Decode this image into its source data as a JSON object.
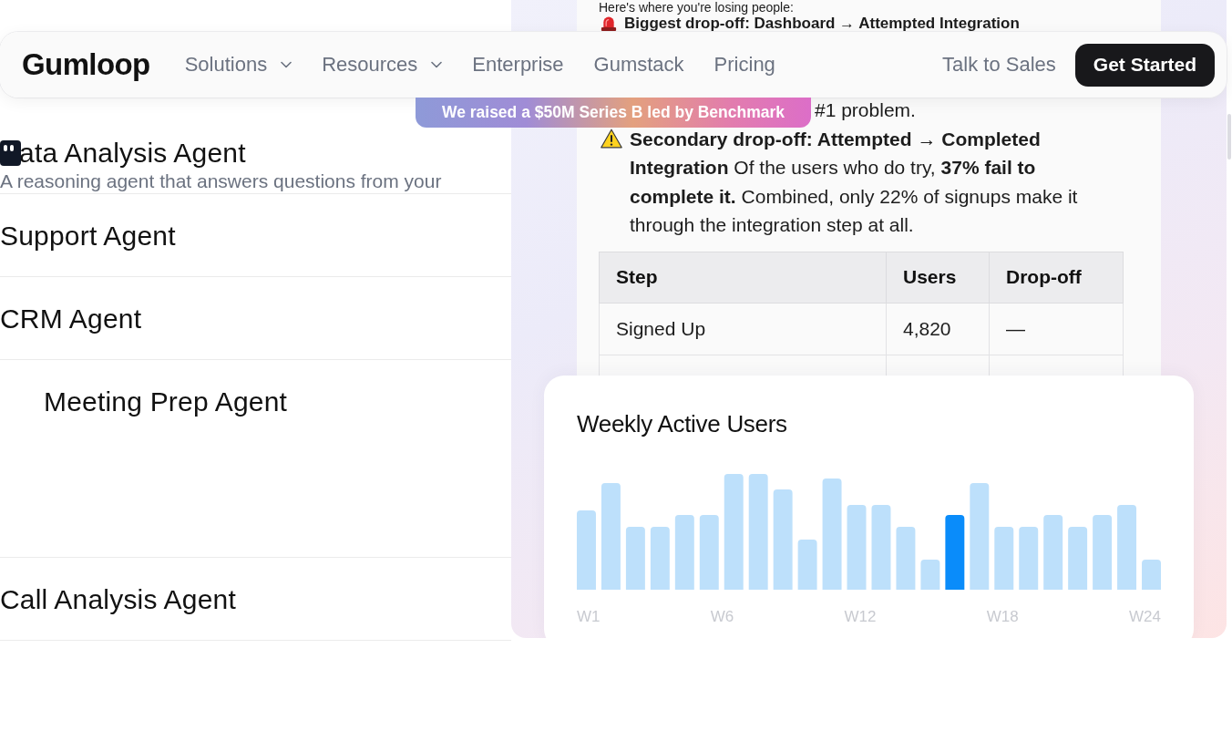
{
  "navbar": {
    "logo": "Gumloop",
    "links": [
      {
        "label": "Solutions",
        "kind": "dropdown"
      },
      {
        "label": "Resources",
        "kind": "dropdown"
      },
      {
        "label": "Enterprise",
        "kind": "link"
      },
      {
        "label": "Gumstack",
        "kind": "link"
      },
      {
        "label": "Pricing",
        "kind": "link"
      }
    ],
    "secondary_action": "Talk to Sales",
    "primary_action": "Get Started"
  },
  "announcement": "We raised a $50M Series B led by Benchmark",
  "agents": [
    {
      "kind": "featured",
      "title": "ata Analysis Agent",
      "description": "A reasoning agent that answers questions from your"
    },
    {
      "kind": "plain",
      "title": "Support Agent"
    },
    {
      "kind": "plain",
      "title": "CRM Agent"
    },
    {
      "kind": "expanded",
      "title": "Meeting Prep Agent"
    },
    {
      "kind": "plain",
      "title": "Call Analysis Agent"
    }
  ],
  "report": {
    "intro": "Here's where you're losing people:",
    "blocks": [
      {
        "kind": "alert",
        "text": "Biggest drop-off: Dashboard → Attempted Integration"
      },
      {
        "kind": "fragment",
        "text": "#1 problem."
      },
      {
        "kind": "warning",
        "text": "**Secondary drop-off: Attempted → Completed Integration** Of the users who do try, **37% fail to complete it.** Combined, only 22% of signups make it through the integration step at all."
      }
    ],
    "table": {
      "columns": [
        "Step",
        "Users",
        "Drop-off"
      ],
      "rows": [
        [
          "Signed Up",
          "4,820",
          "—"
        ]
      ]
    }
  },
  "chart": {
    "title": "Weekly Active Users",
    "x_labels": [
      "W1",
      "W6",
      "W12",
      "W18",
      "W24"
    ],
    "bars": [
      {
        "selected": false
      },
      {
        "selected": false
      },
      {
        "selected": false
      },
      {
        "selected": false
      },
      {
        "selected": false
      },
      {
        "selected": false
      },
      {
        "selected": false
      },
      {
        "selected": false
      },
      {
        "selected": false
      },
      {
        "selected": false
      },
      {
        "selected": false
      },
      {
        "selected": false
      },
      {
        "selected": false
      },
      {
        "selected": false
      },
      {
        "selected": false
      },
      {
        "selected": true
      },
      {
        "selected": false
      },
      {
        "selected": false
      },
      {
        "selected": false
      },
      {
        "selected": false
      },
      {
        "selected": false
      },
      {
        "selected": false
      },
      {
        "selected": false
      },
      {
        "selected": false
      }
    ]
  }
}
